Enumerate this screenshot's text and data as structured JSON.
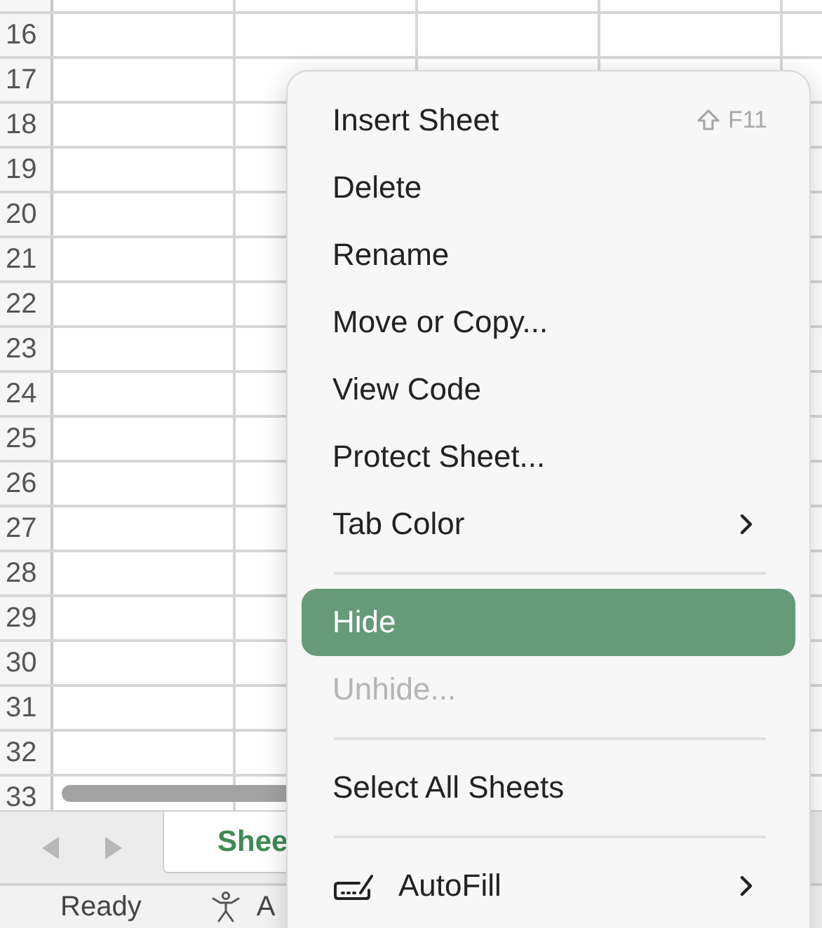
{
  "grid": {
    "row_headers": [
      "16",
      "17",
      "18",
      "19",
      "20",
      "21",
      "22",
      "23",
      "24",
      "25",
      "26",
      "27",
      "28",
      "29",
      "30",
      "31",
      "32",
      "33"
    ]
  },
  "sheet_tabs": [
    {
      "label": "Shee",
      "selected": true
    }
  ],
  "status_bar": {
    "mode": "Ready",
    "accessibility": "A"
  },
  "context_menu": {
    "items": [
      {
        "kind": "item",
        "label": "Insert Sheet",
        "shortcut": "F11",
        "disabled": false,
        "selected": false,
        "submenu": false
      },
      {
        "kind": "item",
        "label": "Delete",
        "disabled": false,
        "selected": false,
        "submenu": false
      },
      {
        "kind": "item",
        "label": "Rename",
        "disabled": false,
        "selected": false,
        "submenu": false
      },
      {
        "kind": "item",
        "label": "Move or Copy...",
        "disabled": false,
        "selected": false,
        "submenu": false
      },
      {
        "kind": "item",
        "label": "View Code",
        "disabled": false,
        "selected": false,
        "submenu": false
      },
      {
        "kind": "item",
        "label": "Protect Sheet...",
        "disabled": false,
        "selected": false,
        "submenu": false
      },
      {
        "kind": "item",
        "label": "Tab Color",
        "disabled": false,
        "selected": false,
        "submenu": true
      },
      {
        "kind": "separator"
      },
      {
        "kind": "item",
        "label": "Hide",
        "disabled": false,
        "selected": true,
        "submenu": false
      },
      {
        "kind": "item",
        "label": "Unhide...",
        "disabled": true,
        "selected": false,
        "submenu": false
      },
      {
        "kind": "separator"
      },
      {
        "kind": "item",
        "label": "Select All Sheets",
        "disabled": false,
        "selected": false,
        "submenu": false
      },
      {
        "kind": "separator"
      },
      {
        "kind": "icon_item",
        "label": "AutoFill",
        "disabled": false,
        "selected": false,
        "submenu": true
      }
    ]
  }
}
